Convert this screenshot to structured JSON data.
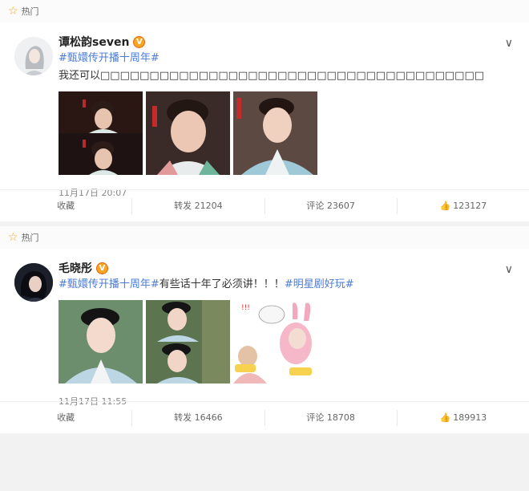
{
  "hot_label": "热门",
  "posts": [
    {
      "author": "谭松韵seven",
      "verified_icon": "verified-badge-icon",
      "line1": "#甄嬛传开播十周年#",
      "line2": "我还可以□□□□□□□□□□□□□□□□□□□□□□□□□□□□□□□□□□□□□□□",
      "time": "11月17日 20:07",
      "actions": {
        "fav": "收藏",
        "repost": "转发 21204",
        "comment": "评论 23607",
        "like": "123127"
      }
    },
    {
      "author": "毛晓彤",
      "verified_icon": "verified-badge-icon",
      "tag1": "#甄嬛传开播十周年#",
      "plain": "有些话十年了必须讲！！！",
      "tag2": "#明星剧好玩#",
      "time": "11月17日 11:55",
      "actions": {
        "fav": "收藏",
        "repost": "转发 16466",
        "comment": "评论 18708",
        "like": "189913"
      }
    }
  ],
  "colors": {
    "link": "#4d7bd6",
    "badge": "#f5a623",
    "hot_star": "#f5a623"
  }
}
